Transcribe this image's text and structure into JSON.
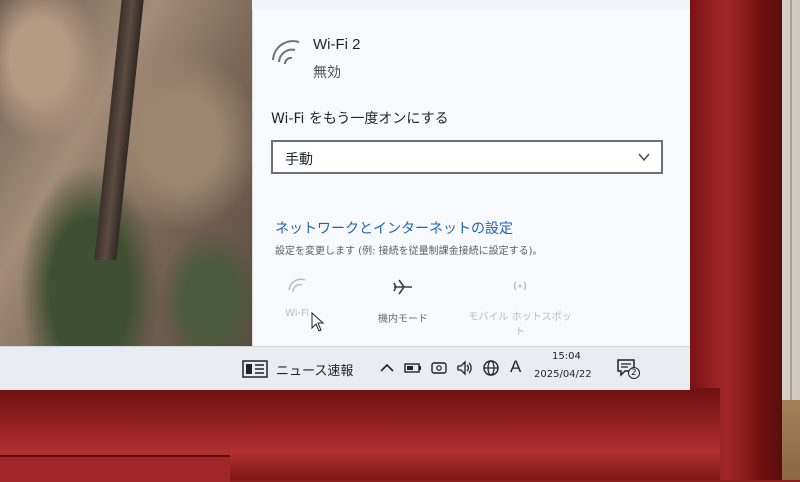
{
  "wifi": {
    "name": "Wi-Fi 2",
    "status": "無効",
    "reconnect_label": "Wi-Fi をもう一度オンにする",
    "reconnect_option": "手動"
  },
  "settings": {
    "link": "ネットワークとインターネットの設定",
    "description": "設定を変更します (例: 接続を従量制課金接続に設定する)。"
  },
  "quick_actions": [
    {
      "label": "Wi-Fi",
      "icon": "wifi-icon",
      "enabled": false
    },
    {
      "label": "機内モード",
      "icon": "airplane-icon",
      "enabled": true
    },
    {
      "label": "モバイル ホットスポット",
      "icon": "hotspot-icon",
      "enabled": false
    }
  ],
  "taskbar": {
    "news_label": "ニュース速報",
    "ime_mode": "A",
    "time": "15:04",
    "date": "2025/04/22",
    "notification_count": "2",
    "tray_icons": [
      "chevron-up-icon",
      "battery-icon",
      "meet-now-icon",
      "volume-icon",
      "network-globe-icon"
    ]
  },
  "colors": {
    "link": "#1d64b8",
    "panel_bg": "#f7f9fc",
    "laptop_red": "#8e1e20"
  }
}
